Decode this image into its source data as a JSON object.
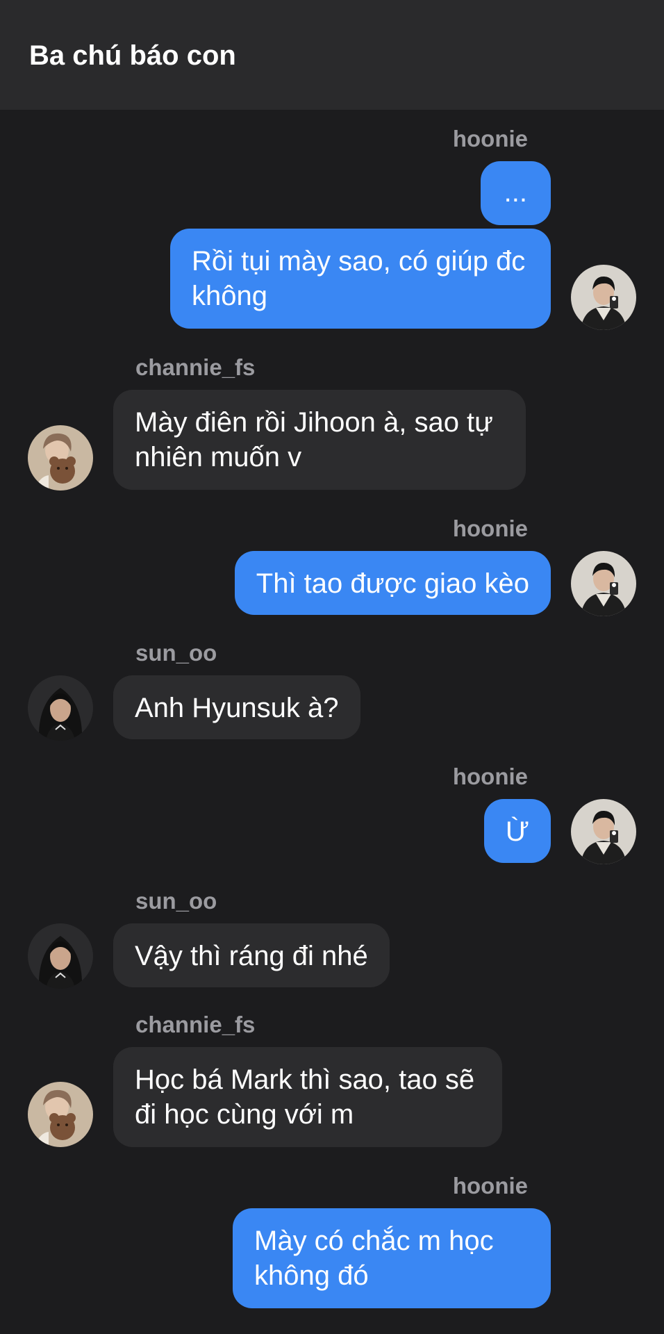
{
  "header": {
    "title": "Ba chú báo con"
  },
  "messages": [
    {
      "sender": "hoonie",
      "side": "right",
      "text": "..."
    },
    {
      "sender": "",
      "side": "right",
      "text": "Rồi tụi mày sao, có giúp đc không"
    },
    {
      "sender": "channie_fs",
      "side": "left",
      "text": "Mày điên rồi Jihoon à, sao tự nhiên muốn v"
    },
    {
      "sender": "hoonie",
      "side": "right",
      "text": "Thì tao được giao kèo"
    },
    {
      "sender": "sun_oo",
      "side": "left",
      "text": "Anh Hyunsuk à?"
    },
    {
      "sender": "hoonie",
      "side": "right",
      "text": "Ừ"
    },
    {
      "sender": "sun_oo",
      "side": "left",
      "text": "Vậy thì ráng đi nhé"
    },
    {
      "sender": "channie_fs",
      "side": "left",
      "text": "Học bá Mark thì sao, tao sẽ đi học cùng với m"
    },
    {
      "sender": "hoonie",
      "side": "right",
      "text": "Mày có chắc m học không đó"
    }
  ],
  "colors": {
    "background": "#1c1c1e",
    "header": "#2a2a2c",
    "outgoing_bubble": "#3a87f3",
    "incoming_bubble": "#2c2c2e",
    "sender_name": "#9b9ba0"
  }
}
